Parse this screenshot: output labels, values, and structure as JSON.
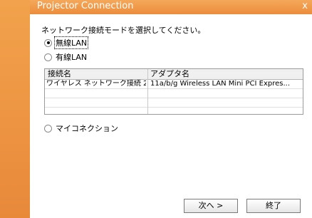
{
  "window": {
    "title": "Projector Connection",
    "close_glyph": "x"
  },
  "prompt": "ネットワーク接続モードを選択してください。",
  "options": {
    "wireless": {
      "label": "無線LAN",
      "selected": true
    },
    "wired": {
      "label": "有線LAN",
      "selected": false
    },
    "my_connection": {
      "label": "マイコネクション",
      "selected": false
    }
  },
  "table": {
    "headers": [
      "接続名",
      "アダプタ名"
    ],
    "rows": [
      [
        "ワイヤレス ネットワーク接続 2",
        "11a/b/g Wireless LAN Mini PCI Expres..."
      ]
    ]
  },
  "buttons": {
    "next": "次へ >",
    "finish": "終了"
  },
  "colors": {
    "accent": "#ec8c3c"
  }
}
